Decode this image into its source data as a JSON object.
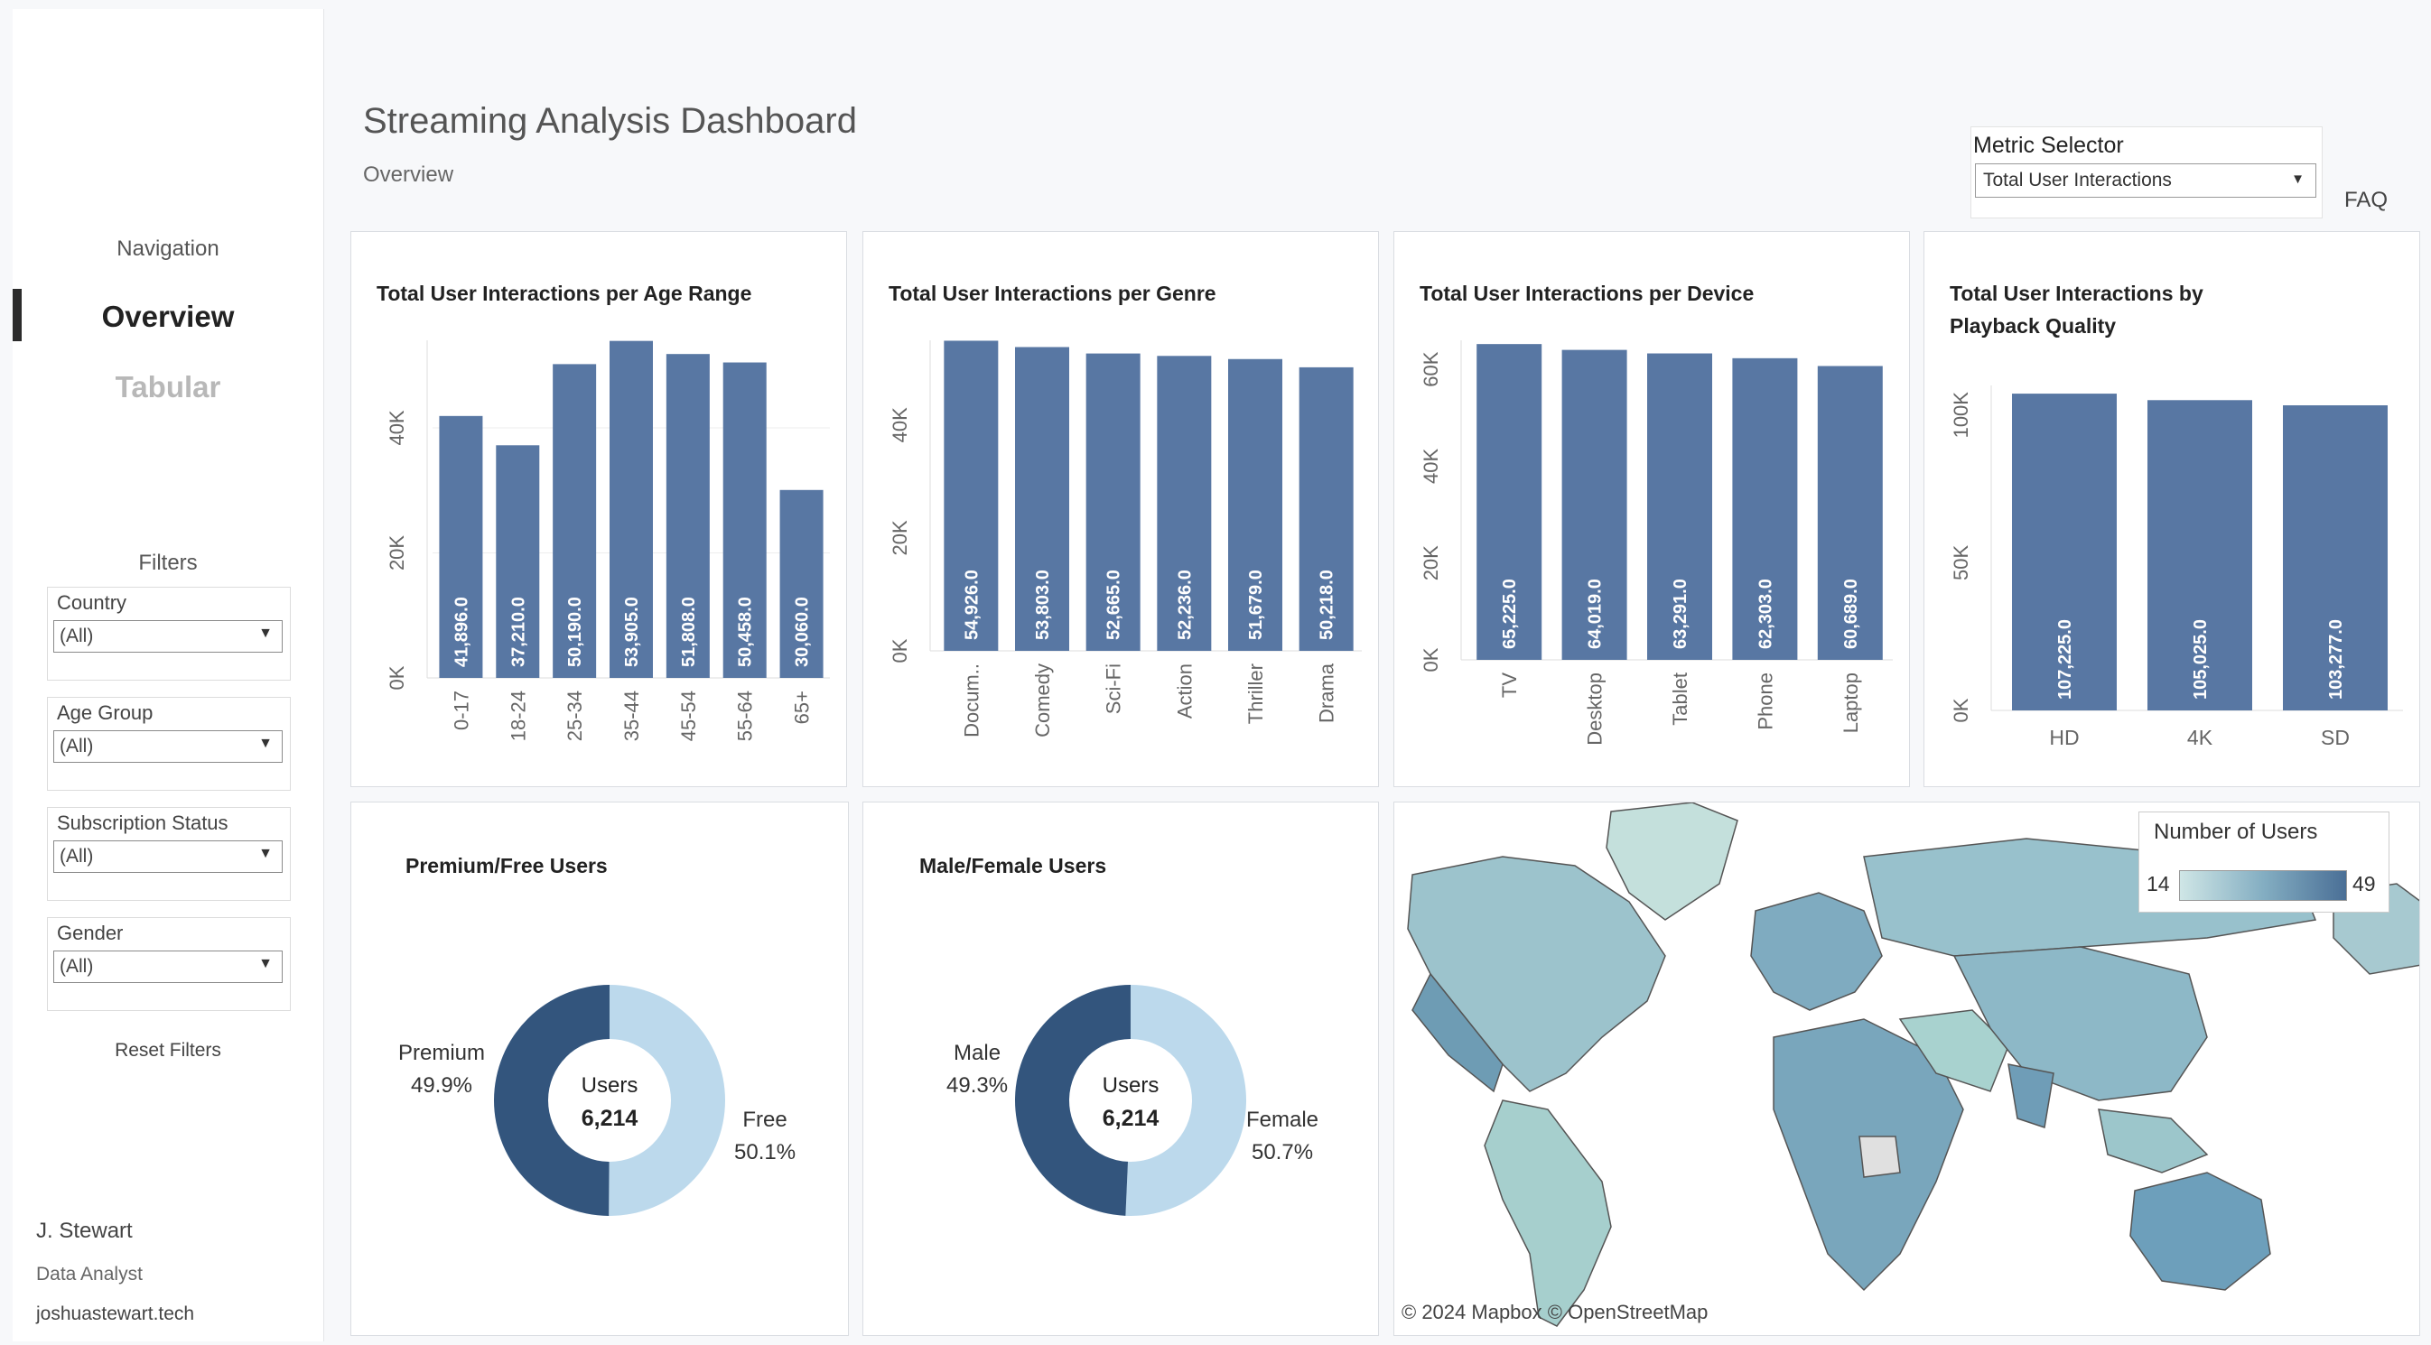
{
  "sidebar": {
    "navigation_title": "Navigation",
    "nav_items": [
      "Overview",
      "Tabular"
    ],
    "filters_title": "Filters",
    "filters": [
      {
        "label": "Country",
        "value": "(All)"
      },
      {
        "label": "Age Group",
        "value": "(All)"
      },
      {
        "label": "Subscription Status",
        "value": "(All)"
      },
      {
        "label": "Gender",
        "value": "(All)"
      }
    ],
    "reset_label": "Reset Filters",
    "author": {
      "name": "J. Stewart",
      "role": "Data Analyst",
      "site": "joshuastewart.tech"
    }
  },
  "header": {
    "title": "Streaming Analysis Dashboard",
    "subtitle": "Overview",
    "metric_selector": {
      "label": "Metric Selector",
      "value": "Total User Interactions"
    },
    "faq": "FAQ"
  },
  "colors": {
    "bar": "#5877a3",
    "donut_dark": "#33557d",
    "donut_light": "#bcd9ec"
  },
  "chart_data": [
    {
      "type": "bar",
      "title": "Total User Interactions per Age Range",
      "categories": [
        "0-17",
        "18-24",
        "25-34",
        "35-44",
        "45-54",
        "55-64",
        "65+"
      ],
      "values": [
        41896.0,
        37210.0,
        50190.0,
        53905.0,
        51808.0,
        50458.0,
        30060.0
      ],
      "value_labels": [
        "41,896.0",
        "37,210.0",
        "50,190.0",
        "53,905.0",
        "51,808.0",
        "50,458.0",
        "30,060.0"
      ],
      "y_ticks": [
        0,
        20000,
        40000
      ],
      "y_tick_labels": [
        "0K",
        "20K",
        "40K"
      ],
      "ylim": [
        0,
        54000
      ],
      "grid": true
    },
    {
      "type": "bar",
      "title": "Total User Interactions per Genre",
      "categories": [
        "Docum..",
        "Comedy",
        "Sci-Fi",
        "Action",
        "Thriller",
        "Drama"
      ],
      "values": [
        54926.0,
        53803.0,
        52665.0,
        52236.0,
        51679.0,
        50218.0
      ],
      "value_labels": [
        "54,926.0",
        "53,803.0",
        "52,665.0",
        "52,236.0",
        "51,679.0",
        "50,218.0"
      ],
      "y_ticks": [
        0,
        20000,
        40000
      ],
      "y_tick_labels": [
        "0K",
        "20K",
        "40K"
      ],
      "ylim": [
        0,
        55000
      ],
      "grid": false
    },
    {
      "type": "bar",
      "title": "Total User Interactions per Device",
      "categories": [
        "TV",
        "Desktop",
        "Tablet",
        "Phone",
        "Laptop"
      ],
      "values": [
        65225.0,
        64019.0,
        63291.0,
        62303.0,
        60689.0
      ],
      "value_labels": [
        "65,225.0",
        "64,019.0",
        "63,291.0",
        "62,303.0",
        "60,689.0"
      ],
      "y_ticks": [
        0,
        20000,
        40000,
        60000
      ],
      "y_tick_labels": [
        "0K",
        "20K",
        "40K",
        "60K"
      ],
      "ylim": [
        0,
        66000
      ],
      "grid": false
    },
    {
      "type": "bar",
      "title": "Total User Interactions by Playback Quality",
      "categories": [
        "HD",
        "4K",
        "SD"
      ],
      "values": [
        107225.0,
        105025.0,
        103277.0
      ],
      "value_labels": [
        "107,225.0",
        "105,025.0",
        "103,277.0"
      ],
      "y_ticks": [
        0,
        50000,
        100000
      ],
      "y_tick_labels": [
        "0K",
        "50K",
        "100K"
      ],
      "ylim": [
        0,
        110000
      ],
      "grid": false
    },
    {
      "type": "pie",
      "title": "Premium/Free Users",
      "center_label": "Users",
      "center_value": "6,214",
      "slices": [
        {
          "name": "Premium",
          "percent": 49.9,
          "label": "49.9%"
        },
        {
          "name": "Free",
          "percent": 50.1,
          "label": "50.1%"
        }
      ]
    },
    {
      "type": "pie",
      "title": "Male/Female Users",
      "center_label": "Users",
      "center_value": "6,214",
      "slices": [
        {
          "name": "Male",
          "percent": 49.3,
          "label": "49.3%"
        },
        {
          "name": "Female",
          "percent": 50.7,
          "label": "50.7%"
        }
      ]
    }
  ],
  "map": {
    "legend_title": "Number of Users",
    "legend_min": "14",
    "legend_max": "49",
    "credit": "© 2024 Mapbox  © OpenStreetMap"
  }
}
